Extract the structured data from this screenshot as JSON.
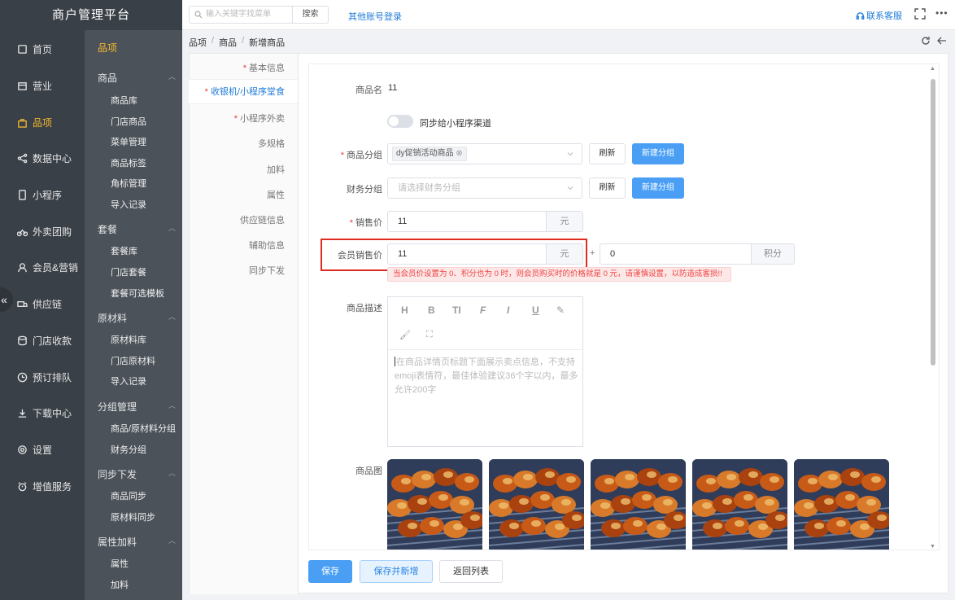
{
  "app": {
    "title": "商户管理平台"
  },
  "topbar": {
    "search_placeholder": "输入关键字找菜单",
    "search_button": "搜索",
    "other_login": "其他账号登录",
    "customer_service": "联系客服",
    "more": "•••"
  },
  "sidebar": {
    "items": [
      {
        "label": "首页",
        "icon": "home-icon"
      },
      {
        "label": "营业",
        "icon": "calendar-icon"
      },
      {
        "label": "品项",
        "icon": "bag-icon"
      },
      {
        "label": "数据中心",
        "icon": "share-icon"
      },
      {
        "label": "小程序",
        "icon": "phone-icon"
      },
      {
        "label": "外卖团购",
        "icon": "bike-icon"
      },
      {
        "label": "会员&营销",
        "icon": "user-icon"
      },
      {
        "label": "供应链",
        "icon": "truck-icon"
      },
      {
        "label": "门店收款",
        "icon": "database-icon"
      },
      {
        "label": "预订排队",
        "icon": "clock-icon"
      },
      {
        "label": "下载中心",
        "icon": "download-icon"
      },
      {
        "label": "设置",
        "icon": "gear-icon"
      },
      {
        "label": "增值服务",
        "icon": "alarm-icon"
      }
    ],
    "active_index": 2
  },
  "subnav": {
    "header": "品项",
    "groups": [
      {
        "label": "商品",
        "links": [
          "商品库",
          "门店商品",
          "菜单管理",
          "商品标签",
          "角标管理",
          "导入记录"
        ]
      },
      {
        "label": "套餐",
        "links": [
          "套餐库",
          "门店套餐",
          "套餐可选模板"
        ]
      },
      {
        "label": "原材料",
        "links": [
          "原材料库",
          "门店原材料",
          "导入记录"
        ]
      },
      {
        "label": "分组管理",
        "links": [
          "商品/原材料分组",
          "财务分组"
        ]
      },
      {
        "label": "同步下发",
        "links": [
          "商品同步",
          "原材料同步"
        ]
      },
      {
        "label": "属性加料",
        "links": [
          "属性",
          "加料"
        ]
      }
    ]
  },
  "breadcrumb": [
    "品项",
    "商品",
    "新增商品"
  ],
  "tabs": [
    {
      "label": "基本信息",
      "required": true
    },
    {
      "label": "收银机/小程序堂食",
      "required": true,
      "active": true
    },
    {
      "label": "小程序外卖",
      "required": true
    },
    {
      "label": "多规格",
      "required": false
    },
    {
      "label": "加料",
      "required": false
    },
    {
      "label": "属性",
      "required": false
    },
    {
      "label": "供应链信息",
      "required": false
    },
    {
      "label": "辅助信息",
      "required": false
    },
    {
      "label": "同步下发",
      "required": false
    }
  ],
  "form": {
    "name_label": "商品名",
    "name_value": "11",
    "sync_label": "同步给小程序渠道",
    "sync_on": false,
    "group_label": "商品分组",
    "group_tag": "dy促销活动商品",
    "refresh": "刷新",
    "new_group": "新建分组",
    "finance_label": "财务分组",
    "finance_placeholder": "请选择财务分组",
    "price_label": "销售价",
    "price_value": "11",
    "unit_yuan": "元",
    "member_label": "会员销售价",
    "member_value": "11",
    "plus": "+",
    "points_value": "0",
    "unit_points": "积分",
    "warning": "当会员价设置为 0、积分也为 0 时，则会员购买时的价格就是 0 元，请谨慎设置，以防造成客损!!",
    "desc_label": "商品描述",
    "desc_placeholder": "在商品详情页标题下面展示卖点信息，不支持emoji表情符，最佳体验建议36个字以内，最多允许200字",
    "toolbar": [
      "H",
      "B",
      "TI",
      "F",
      "I",
      "U",
      "✎",
      "🖌",
      "⛶"
    ],
    "image_label": "商品图",
    "image_count": 5
  },
  "footer": {
    "save": "保存",
    "save_new": "保存并新增",
    "back_list": "返回列表"
  },
  "colors": {
    "accent": "#4a9ff5",
    "brand_dark": "#3a4047",
    "active_yellow": "#f5b82e",
    "highlight": "#e02b20"
  }
}
